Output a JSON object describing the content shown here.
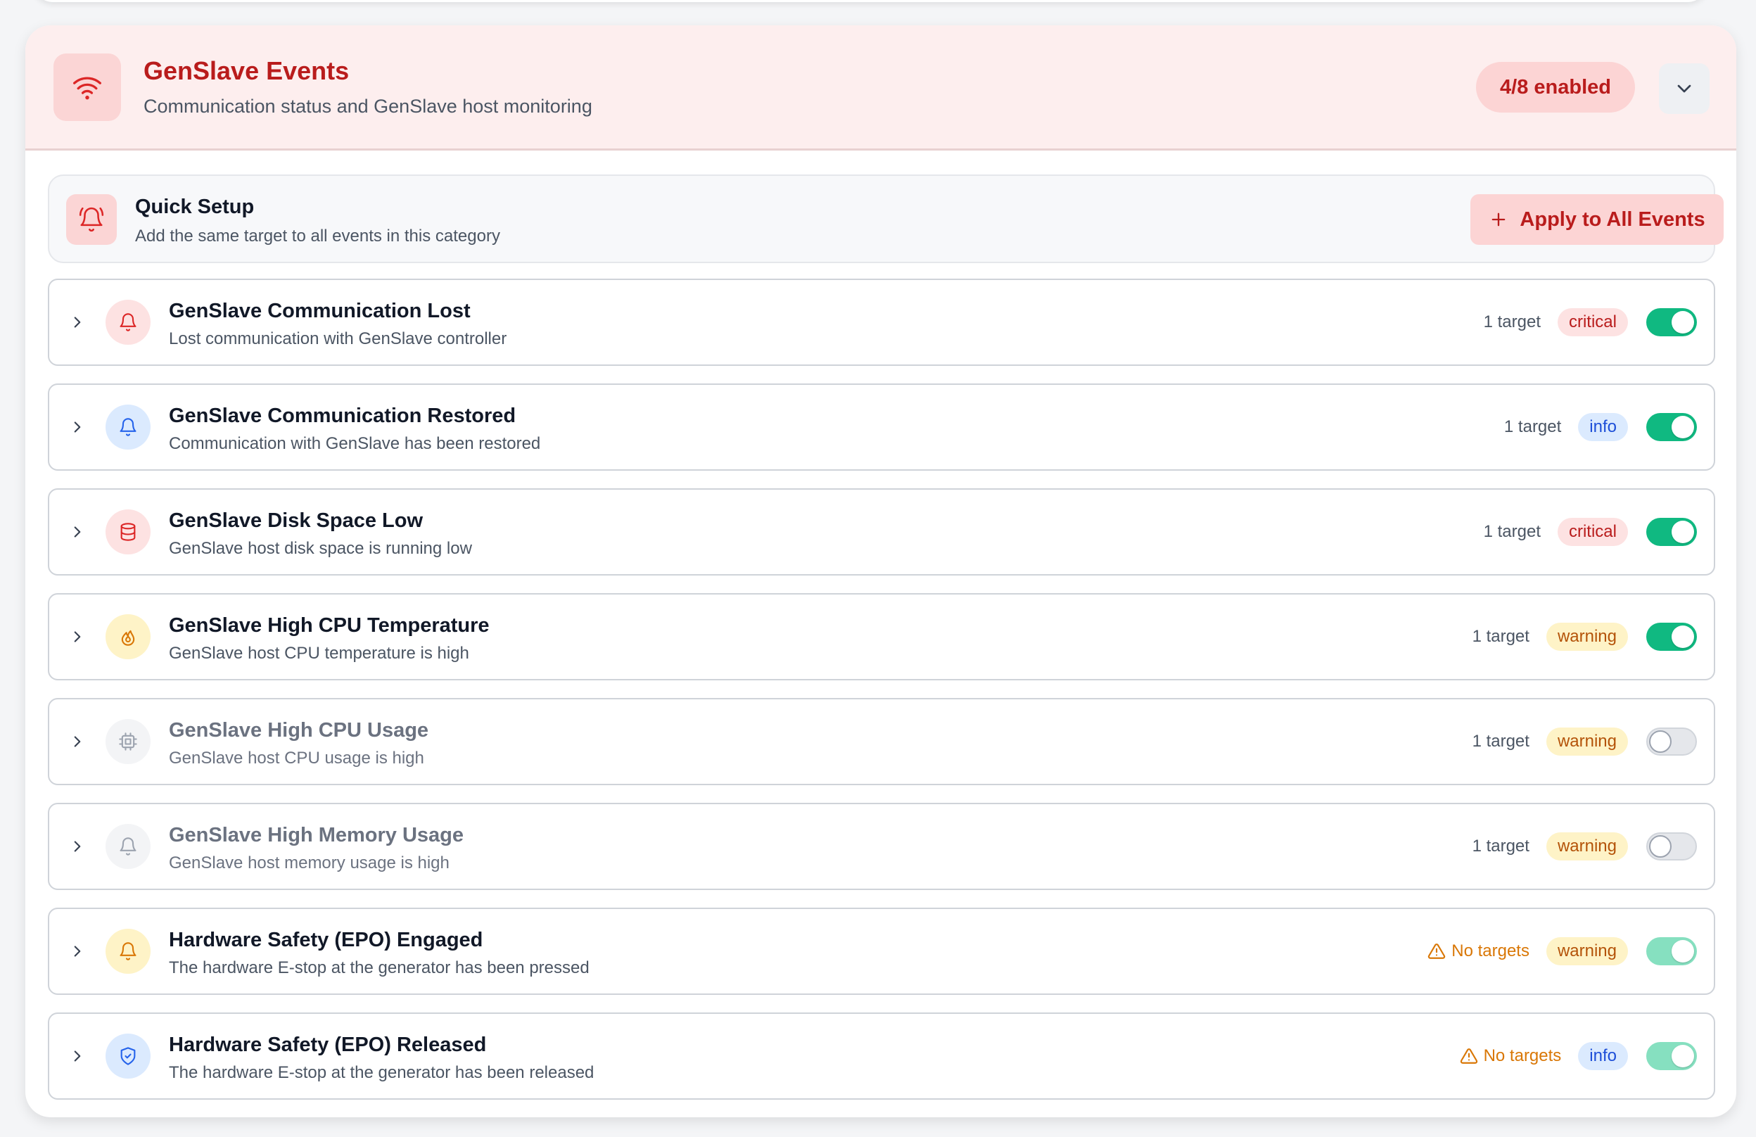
{
  "category": {
    "title": "GenSlave Events",
    "subtitle": "Communication status and GenSlave host monitoring",
    "enabled_count": "4/8 enabled",
    "icon": "wifi-icon",
    "accent": "#b91c1c"
  },
  "quick_setup": {
    "title": "Quick Setup",
    "subtitle": "Add the same target to all events in this category",
    "apply_label": "Apply to All Events",
    "icon": "bell-ring-icon"
  },
  "events": [
    {
      "title": "GenSlave Communication Lost",
      "description": "Lost communication with GenSlave controller",
      "targets": "1 target",
      "severity": "critical",
      "enabled": true,
      "icon": "bell-icon"
    },
    {
      "title": "GenSlave Communication Restored",
      "description": "Communication with GenSlave has been restored",
      "targets": "1 target",
      "severity": "info",
      "enabled": true,
      "icon": "bell-icon"
    },
    {
      "title": "GenSlave Disk Space Low",
      "description": "GenSlave host disk space is running low",
      "targets": "1 target",
      "severity": "critical",
      "enabled": true,
      "icon": "database-icon"
    },
    {
      "title": "GenSlave High CPU Temperature",
      "description": "GenSlave host CPU temperature is high",
      "targets": "1 target",
      "severity": "warning",
      "enabled": true,
      "icon": "flame-icon"
    },
    {
      "title": "GenSlave High CPU Usage",
      "description": "GenSlave host CPU usage is high",
      "targets": "1 target",
      "severity": "warning",
      "enabled": false,
      "icon": "cpu-icon"
    },
    {
      "title": "GenSlave High Memory Usage",
      "description": "GenSlave host memory usage is high",
      "targets": "1 target",
      "severity": "warning",
      "enabled": false,
      "icon": "bell-icon"
    },
    {
      "title": "Hardware Safety (EPO) Engaged",
      "description": "The hardware E-stop at the generator has been pressed",
      "targets": "No targets",
      "severity": "warning",
      "enabled": true,
      "icon": "bell-icon"
    },
    {
      "title": "Hardware Safety (EPO) Released",
      "description": "The hardware E-stop at the generator has been released",
      "targets": "No targets",
      "severity": "info",
      "enabled": true,
      "icon": "shield-check-icon"
    }
  ]
}
